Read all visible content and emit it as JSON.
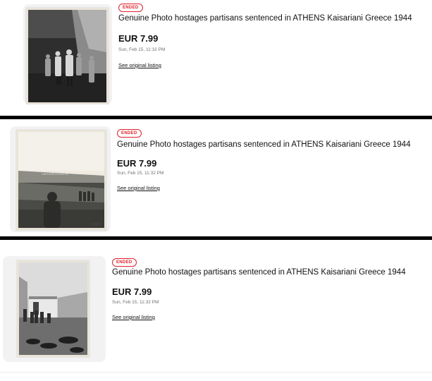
{
  "listings": [
    {
      "status": "ENDED",
      "title": "Genuine Photo hostages partisans sentenced in ATHENS Kaisariani Greece 1944",
      "price": "EUR 7.99",
      "date": "Sun, Feb 15, 11:32 PM",
      "link_label": "See original listing"
    },
    {
      "status": "ENDED",
      "title": "Genuine Photo hostages partisans sentenced in ATHENS Kaisariani Greece 1944",
      "price": "EUR 7.99",
      "date": "Sun, Feb 15, 11:32 PM",
      "link_label": "See original listing"
    },
    {
      "status": "ENDED",
      "title": "Genuine Photo hostages partisans sentenced in ATHENS Kaisariani Greece 1944",
      "price": "EUR 7.99",
      "date": "Sun, Feb 15, 11:32 PM",
      "link_label": "See original listing"
    }
  ],
  "colors": {
    "ended_badge": "#e0212b",
    "divider": "#000000"
  }
}
